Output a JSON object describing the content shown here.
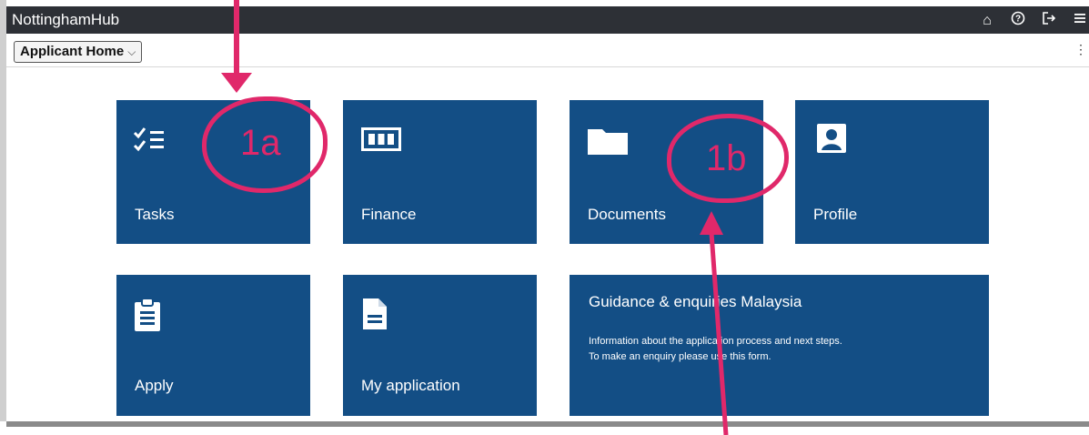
{
  "app": {
    "title": "NottinghamHub"
  },
  "header_icons": [
    "home-icon",
    "help-icon",
    "sign-out-icon",
    "menu-icon"
  ],
  "subheader": {
    "page_select": "Applicant Home"
  },
  "tiles": {
    "tasks": {
      "label": "Tasks",
      "icon": "checklist-icon"
    },
    "finance": {
      "label": "Finance",
      "icon": "wallet-icon"
    },
    "documents": {
      "label": "Documents",
      "icon": "folder-icon"
    },
    "profile": {
      "label": "Profile",
      "icon": "person-icon"
    },
    "apply": {
      "label": "Apply",
      "icon": "clipboard-icon"
    },
    "my_application": {
      "label": "My application",
      "icon": "document-icon"
    },
    "guidance": {
      "title": "Guidance & enquiries Malaysia",
      "line1": "Information about the application process and next steps.",
      "line2": "To make an enquiry please use this form."
    }
  },
  "annotations": {
    "a": "1a",
    "b": "1b"
  },
  "colors": {
    "tile": "#134e85",
    "topbar": "#2d3036",
    "annotation": "#e0286a"
  }
}
